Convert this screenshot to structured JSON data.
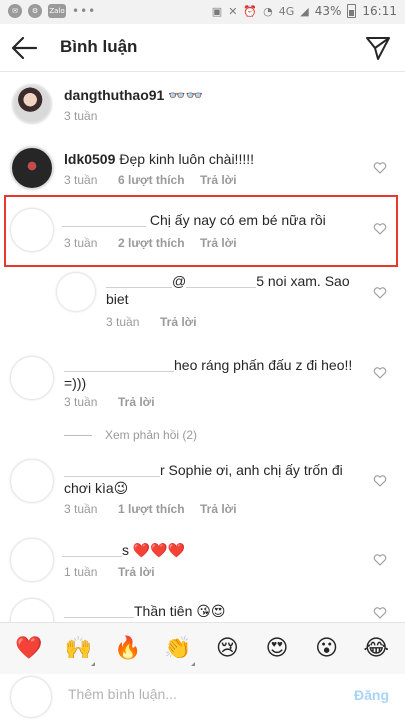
{
  "status_bar": {
    "app_icons": [
      "messenger-icon",
      "settings-icon",
      "zalo-icon"
    ],
    "zalo_label": "Zalo",
    "dots": "•••",
    "network": "4G",
    "battery": "43%",
    "time": "16:11"
  },
  "header": {
    "title": "Bình luận",
    "back_icon": "arrow-left-icon",
    "send_icon": "paper-plane-icon"
  },
  "caption": {
    "username": "dangthuthao91",
    "text": "👓👓",
    "time": "3 tuần"
  },
  "comments": [
    {
      "username": "ldk0509",
      "text": "Đẹp kinh luôn chài!!!!!",
      "time": "3 tuần",
      "likes": "6 lượt thích",
      "reply": "Trả lời"
    },
    {
      "username": "",
      "text": "Chị ấy nay có em bé nữa rồi",
      "time": "3 tuần",
      "likes": "2 lượt thích",
      "reply": "Trả lời"
    },
    {
      "username": "",
      "text_before": "@",
      "text_after": "5 noi xam. Sao",
      "text_line2": "biet",
      "time": "3 tuần",
      "reply": "Trả lời"
    },
    {
      "username": "",
      "text_line1": "heo ráng phấn đấu z đi heo!!",
      "text_line2": "=)))",
      "time": "3 tuần",
      "reply": "Trả lời"
    },
    {
      "username": "",
      "text_line1": "r Sophie ơi, anh chị ấy trốn đi",
      "text_line2": "chơi kìa😉",
      "time": "3 tuần",
      "likes": "1 lượt thích",
      "reply": "Trả lời"
    },
    {
      "username": "",
      "text": "s ❤️❤️❤️",
      "time": "1 tuần",
      "reply": "Trả lời"
    },
    {
      "username": "",
      "text": "Thần tiên 😘😍"
    }
  ],
  "view_replies": "Xem phản hồi (2)",
  "emoji_bar": [
    "❤️",
    "🙌",
    "🔥",
    "👏",
    "😢",
    "😍",
    "😮",
    "😂"
  ],
  "input": {
    "placeholder": "Thêm bình luận...",
    "post_label": "Đăng"
  },
  "colors": {
    "highlight": "#e5392d",
    "meta_text": "#9a9a9a",
    "post_button": "#a9d4f5"
  }
}
